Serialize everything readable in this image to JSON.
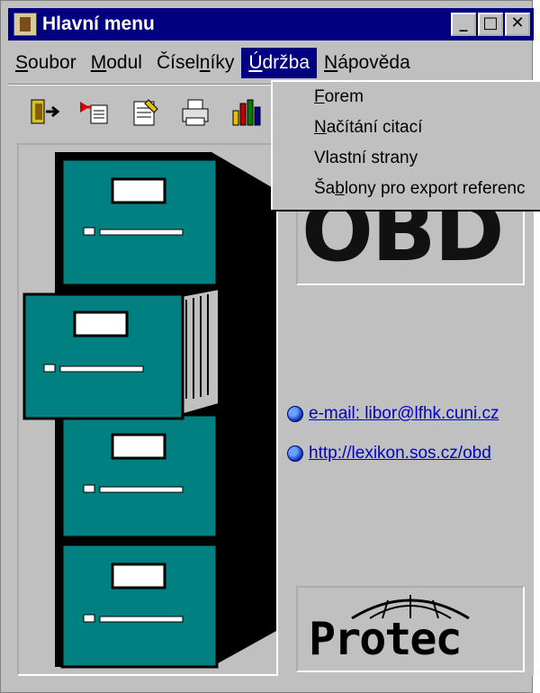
{
  "window": {
    "title": "Hlavní menu",
    "buttons": [
      "_",
      "□",
      "✕"
    ]
  },
  "menubar": {
    "items": [
      {
        "pre": "",
        "accel": "S",
        "post": "oubor"
      },
      {
        "pre": "",
        "accel": "M",
        "post": "odul"
      },
      {
        "pre": "Čísel",
        "accel": "n",
        "post": "íky"
      },
      {
        "pre": "",
        "accel": "Ú",
        "post": "držba"
      },
      {
        "pre": "",
        "accel": "N",
        "post": "ápověda"
      }
    ]
  },
  "dropdown": {
    "items": [
      {
        "pre": "",
        "accel": "F",
        "post": "orem"
      },
      {
        "pre": "",
        "accel": "N",
        "post": "ačítání citací"
      },
      {
        "pre": "Vlastní strany",
        "accel": "",
        "post": ""
      },
      {
        "pre": "Ša",
        "accel": "b",
        "post": "lony pro export referenc"
      }
    ]
  },
  "toolbar": {
    "icons": [
      "exit-door-icon",
      "import-icon",
      "notepad-icon",
      "print-icon",
      "chart-icon"
    ]
  },
  "logo": {
    "obd": "OBD",
    "protec": "Protec"
  },
  "links": {
    "email": "e-mail: libor@lfhk.cuni.cz",
    "web": "http://lexikon.sos.cz/obd"
  },
  "colors": {
    "titlebar": "#000080",
    "face": "#c0c0c0",
    "cabinet": "#008080",
    "link": "#0000cc"
  }
}
